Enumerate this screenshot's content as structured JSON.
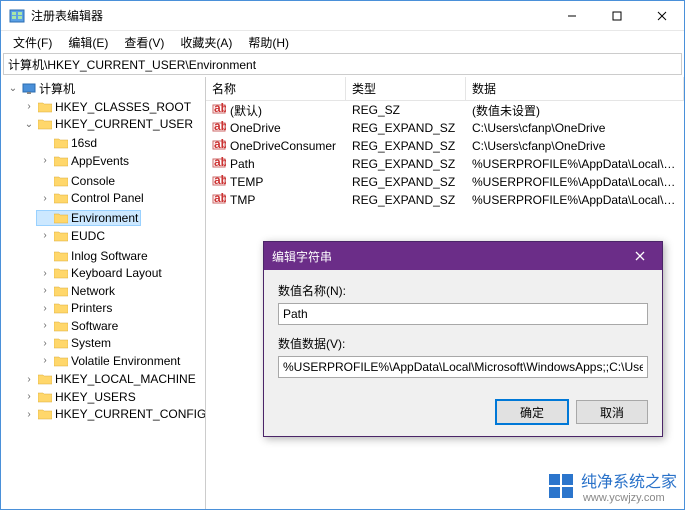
{
  "window": {
    "title": "注册表编辑器",
    "menu": {
      "file": "文件(F)",
      "edit": "编辑(E)",
      "view": "查看(V)",
      "favorites": "收藏夹(A)",
      "help": "帮助(H)"
    },
    "address": "计算机\\HKEY_CURRENT_USER\\Environment"
  },
  "tree": {
    "root": "计算机",
    "hkcr": "HKEY_CLASSES_ROOT",
    "hkcu": "HKEY_CURRENT_USER",
    "hkcu_children": [
      "16sd",
      "AppEvents",
      "Console",
      "Control Panel",
      "Environment",
      "EUDC",
      "Inlog Software",
      "Keyboard Layout",
      "Network",
      "Printers",
      "Software",
      "System",
      "Volatile Environment"
    ],
    "hklm": "HKEY_LOCAL_MACHINE",
    "hku": "HKEY_USERS",
    "hkcc": "HKEY_CURRENT_CONFIG"
  },
  "list": {
    "col_name": "名称",
    "col_type": "类型",
    "col_data": "数据",
    "rows": [
      {
        "name": "(默认)",
        "type": "REG_SZ",
        "data": "(数值未设置)"
      },
      {
        "name": "OneDrive",
        "type": "REG_EXPAND_SZ",
        "data": "C:\\Users\\cfanp\\OneDrive"
      },
      {
        "name": "OneDriveConsumer",
        "type": "REG_EXPAND_SZ",
        "data": "C:\\Users\\cfanp\\OneDrive"
      },
      {
        "name": "Path",
        "type": "REG_EXPAND_SZ",
        "data": "%USERPROFILE%\\AppData\\Local\\Microsoft\\..."
      },
      {
        "name": "TEMP",
        "type": "REG_EXPAND_SZ",
        "data": "%USERPROFILE%\\AppData\\Local\\Temp"
      },
      {
        "name": "TMP",
        "type": "REG_EXPAND_SZ",
        "data": "%USERPROFILE%\\AppData\\Local\\Temp"
      }
    ]
  },
  "dialog": {
    "title": "编辑字符串",
    "name_label": "数值名称(N):",
    "name_value": "Path",
    "data_label": "数值数据(V):",
    "data_value": "%USERPROFILE%\\AppData\\Local\\Microsoft\\WindowsApps;;C:\\Users\\cf.",
    "ok": "确定",
    "cancel": "取消"
  },
  "watermark": {
    "brand": "纯净系统之家",
    "url": "www.ycwjzy.com"
  }
}
